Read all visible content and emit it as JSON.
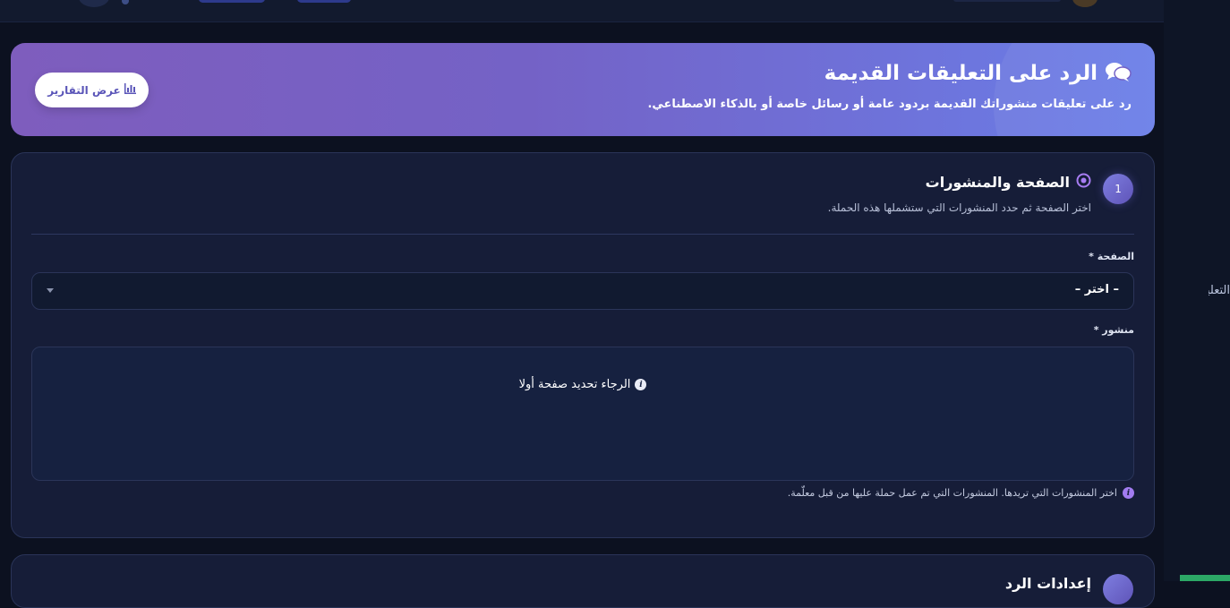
{
  "hero": {
    "title": "الرد على التعليقات القديمة",
    "subtitle": "رد على تعليقات منشوراتك القديمة بردود عامة أو رسائل خاصة أو بالذكاء الاصطناعي.",
    "title_icon": "comments-icon",
    "report_button_label": "عرض التقارير",
    "report_button_icon": "bar-chart-icon"
  },
  "step1": {
    "number": "1",
    "title": "الصفحة والمنشورات",
    "title_icon": "target-icon",
    "subtitle": "اختر الصفحة ثم حدد المنشورات التي ستشملها هذه الحملة.",
    "page_label": "الصفحة *",
    "page_select_value": "– اختر –",
    "post_label": "منشور *",
    "post_empty_message": "الرجاء تحديد صفحة أولا",
    "hint": "اختر المنشورات التي تريدها. المنشورات التي تم عمل حملة عليها من قبل معلّمة."
  },
  "step2": {
    "title": "إعدادات الرد"
  },
  "sidebar": {
    "partial_label": "التعليقات"
  },
  "colors": {
    "background": "#0c1120",
    "card": "#161d38",
    "accent": "#7462c6",
    "hero_start": "#6a7ee8",
    "hero_end": "#7e5dbd"
  }
}
